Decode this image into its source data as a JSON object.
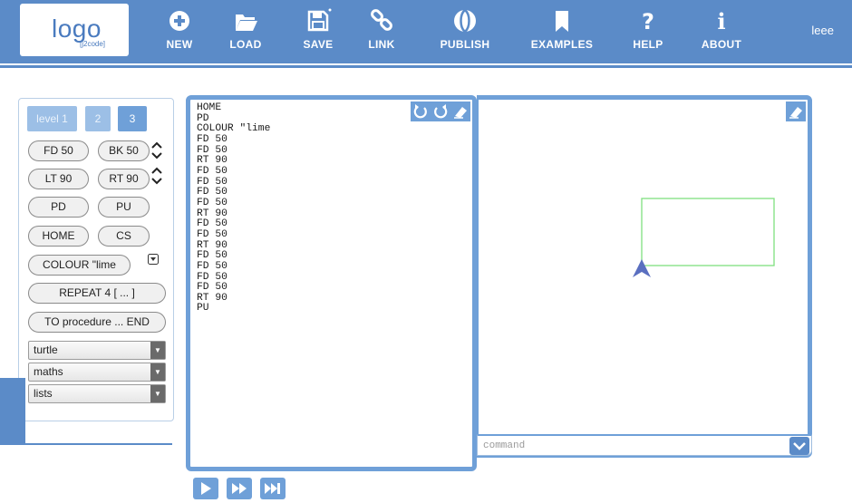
{
  "app": {
    "logo_main": "logo",
    "logo_sub": "[j2code]",
    "user": "leee"
  },
  "nav": [
    {
      "label": "NEW",
      "icon": "plus-circle-icon"
    },
    {
      "label": "LOAD",
      "icon": "folder-open-icon"
    },
    {
      "label": "SAVE",
      "icon": "floppy-disk-icon"
    },
    {
      "label": "LINK",
      "icon": "link-icon"
    },
    {
      "label": "PUBLISH",
      "icon": "globe-icon"
    },
    {
      "label": "EXAMPLES",
      "icon": "bookmark-icon"
    },
    {
      "label": "HELP",
      "icon": "question-icon"
    },
    {
      "label": "ABOUT",
      "icon": "info-icon"
    }
  ],
  "palette": {
    "levels": [
      "level 1",
      "2",
      "3"
    ],
    "selected_level": "3",
    "buttons": {
      "fd": "FD 50",
      "bk": "BK 50",
      "lt": "LT 90",
      "rt": "RT 90",
      "pd": "PD",
      "pu": "PU",
      "home": "HOME",
      "cs": "CS",
      "colour": "COLOUR \"lime",
      "repeat": "REPEAT 4 [ ... ]",
      "to": "TO procedure ... END"
    },
    "dropdowns": [
      "turtle",
      "maths",
      "lists"
    ]
  },
  "editor": {
    "code": "HOME\nPD\nCOLOUR \"lime\nFD 50\nFD 50\nRT 90\nFD 50\nFD 50\nFD 50\nFD 50\nRT 90\nFD 50\nFD 50\nRT 90\nFD 50\nFD 50\nFD 50\nFD 50\nRT 90\nPU"
  },
  "canvas": {
    "line_color": "#7fe07f",
    "turtle_color": "#5a6fc0"
  },
  "command": {
    "placeholder": "command"
  },
  "colors": {
    "accent": "#5b8bc8",
    "panel_border": "#6fa0d8"
  }
}
